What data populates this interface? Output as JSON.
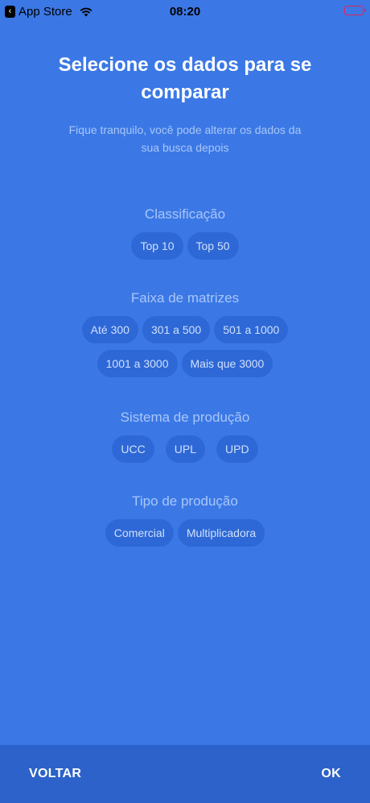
{
  "status_bar": {
    "back_app": "App Store",
    "time": "08:20"
  },
  "header": {
    "title": "Selecione os dados para se comparar",
    "subtitle": "Fique tranquilo, você pode alterar os dados da sua busca depois"
  },
  "sections": {
    "classificacao": {
      "title": "Classificação",
      "options": [
        "Top 10",
        "Top 50"
      ]
    },
    "faixa": {
      "title": "Faixa de matrizes",
      "options": [
        "Até 300",
        "301 a 500",
        "501 a 1000",
        "1001 a 3000",
        "Mais que 3000"
      ]
    },
    "sistema": {
      "title": "Sistema de produção",
      "options": [
        "UCC",
        "UPL",
        "UPD"
      ]
    },
    "tipo": {
      "title": "Tipo de produção",
      "options": [
        "Comercial",
        "Multiplicadora"
      ]
    }
  },
  "footer": {
    "back_label": "VOLTAR",
    "ok_label": "OK"
  },
  "colors": {
    "background": "#3b78e6",
    "chip": "#2e68d6",
    "footer": "#2c62c9",
    "muted_text": "#a9c6f7"
  }
}
